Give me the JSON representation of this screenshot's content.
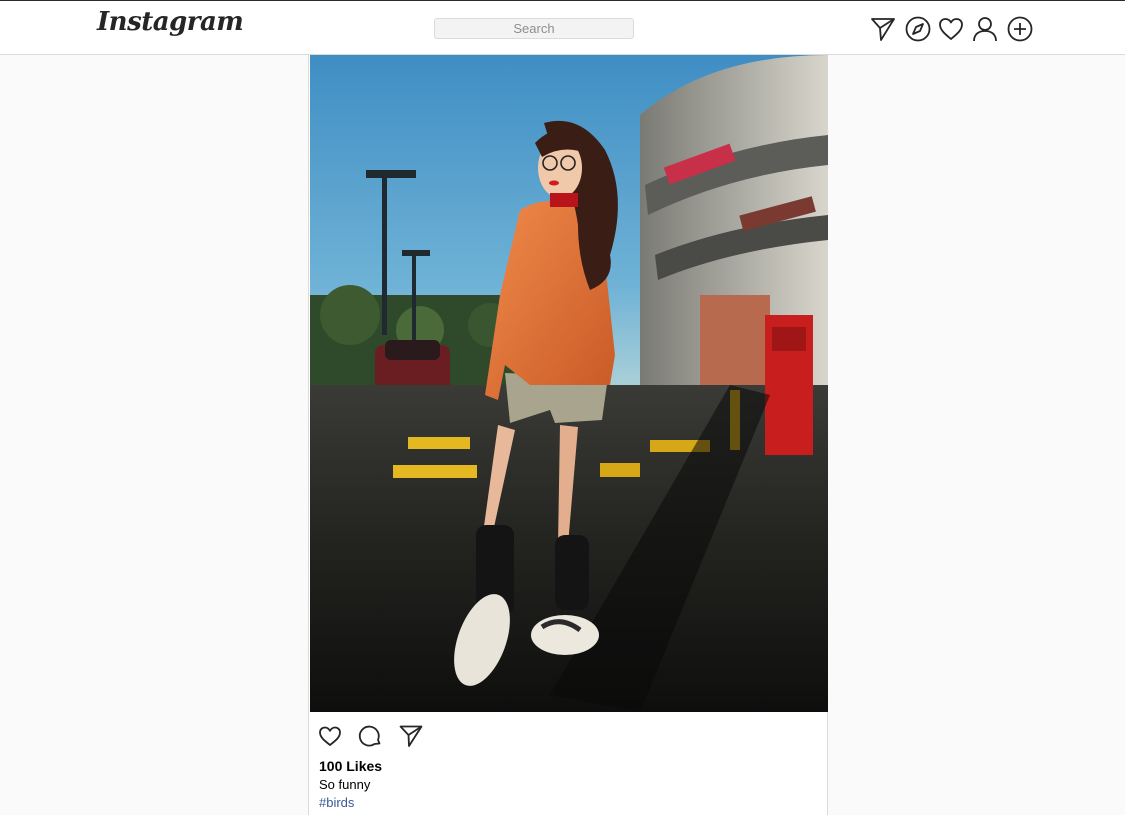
{
  "header": {
    "logo_text": "Instagram",
    "search_placeholder": "Search",
    "icons": [
      "send-icon",
      "explore-icon",
      "heart-icon",
      "profile-icon",
      "add-icon"
    ]
  },
  "post": {
    "likes_text": "100 Likes",
    "caption": "So funny",
    "hashtag": "#birds",
    "actions": [
      "like-icon",
      "comment-icon",
      "share-icon"
    ]
  },
  "colors": {
    "background": "#fafafa",
    "border": "#dbdbdb",
    "text": "#262626",
    "link": "#3b5998"
  }
}
